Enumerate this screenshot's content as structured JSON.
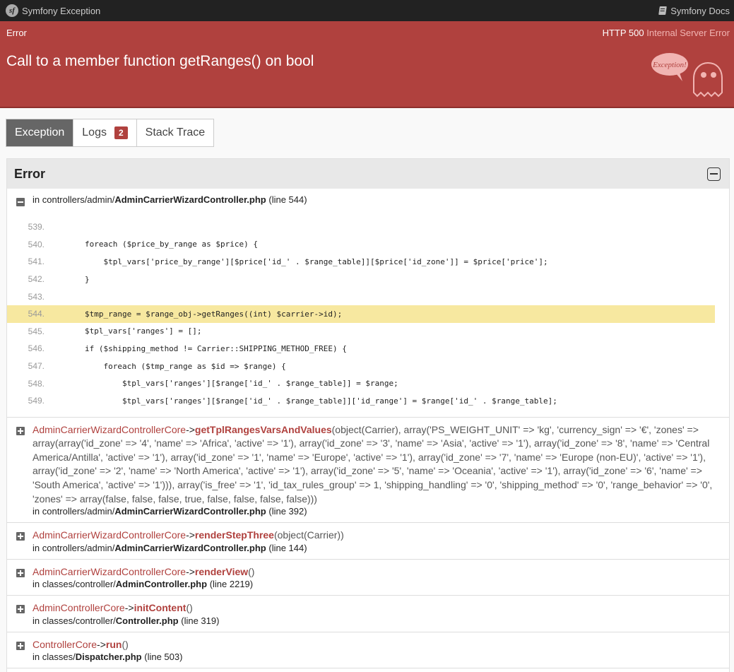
{
  "topbar": {
    "left_label": "Symfony Exception",
    "right_label": "Symfony Docs",
    "logo_text": "sf"
  },
  "statusbar": {
    "left": "Error",
    "code": "HTTP 500",
    "text": "Internal Server Error"
  },
  "header": {
    "title": "Call to a member function getRanges() on bool",
    "ghost_label": "Exception!"
  },
  "tabs": [
    {
      "label": "Exception",
      "active": true
    },
    {
      "label": "Logs",
      "badge": "2"
    },
    {
      "label": "Stack Trace"
    }
  ],
  "panel": {
    "title": "Error"
  },
  "main_frame": {
    "loc_prefix": "in controllers/admin/",
    "file": "AdminCarrierWizardController.php",
    "line": "(line 544)"
  },
  "code_lines": [
    {
      "num": "539.",
      "src": ""
    },
    {
      "num": "540.",
      "src": "        foreach ($price_by_range as $price) {"
    },
    {
      "num": "541.",
      "src": "            $tpl_vars['price_by_range'][$price['id_' . $range_table]][$price['id_zone']] = $price['price'];"
    },
    {
      "num": "542.",
      "src": "        }"
    },
    {
      "num": "543.",
      "src": ""
    },
    {
      "num": "544.",
      "src": "        $tmp_range = $range_obj->getRanges((int) $carrier->id);",
      "highlight": true
    },
    {
      "num": "545.",
      "src": "        $tpl_vars['ranges'] = [];"
    },
    {
      "num": "546.",
      "src": "        if ($shipping_method != Carrier::SHIPPING_METHOD_FREE) {"
    },
    {
      "num": "547.",
      "src": "            foreach ($tmp_range as $id => $range) {"
    },
    {
      "num": "548.",
      "src": "                $tpl_vars['ranges'][$range['id_' . $range_table]] = $range;"
    },
    {
      "num": "549.",
      "src": "                $tpl_vars['ranges'][$range['id_' . $range_table]]['id_range'] = $range['id_' . $range_table];"
    }
  ],
  "frames": [
    {
      "class": "AdminCarrierWizardControllerCore",
      "arrow": "->",
      "method": "getTplRangesVarsAndValues",
      "args": "(object(Carrier), array('PS_WEIGHT_UNIT' => 'kg', 'currency_sign' => '€', 'zones' => array(array('id_zone' => '4', 'name' => 'Africa', 'active' => '1'), array('id_zone' => '3', 'name' => 'Asia', 'active' => '1'), array('id_zone' => '8', 'name' => 'Central America/Antilla', 'active' => '1'), array('id_zone' => '1', 'name' => 'Europe', 'active' => '1'), array('id_zone' => '7', 'name' => 'Europe (non-EU)', 'active' => '1'), array('id_zone' => '2', 'name' => 'North America', 'active' => '1'), array('id_zone' => '5', 'name' => 'Oceania', 'active' => '1'), array('id_zone' => '6', 'name' => 'South America', 'active' => '1'))), array('is_free' => '1', 'id_tax_rules_group' => 1, 'shipping_handling' => '0', 'shipping_method' => '0', 'range_behavior' => '0', 'zones' => array(false, false, false, true, false, false, false, false)))",
      "loc_prefix": "in controllers/admin/",
      "file": "AdminCarrierWizardController.php",
      "line": "(line 392)"
    },
    {
      "class": "AdminCarrierWizardControllerCore",
      "arrow": "->",
      "method": "renderStepThree",
      "args": "(object(Carrier))",
      "loc_prefix": "in controllers/admin/",
      "file": "AdminCarrierWizardController.php",
      "line": "(line 144)"
    },
    {
      "class": "AdminCarrierWizardControllerCore",
      "arrow": "->",
      "method": "renderView",
      "args": "()",
      "loc_prefix": "in classes/controller/",
      "file": "AdminController.php",
      "line": "(line 2219)"
    },
    {
      "class": "AdminControllerCore",
      "arrow": "->",
      "method": "initContent",
      "args": "()",
      "loc_prefix": "in classes/controller/",
      "file": "Controller.php",
      "line": "(line 319)"
    },
    {
      "class": "ControllerCore",
      "arrow": "->",
      "method": "run",
      "args": "()",
      "loc_prefix": "in classes/",
      "file": "Dispatcher.php",
      "line": "(line 503)"
    }
  ]
}
